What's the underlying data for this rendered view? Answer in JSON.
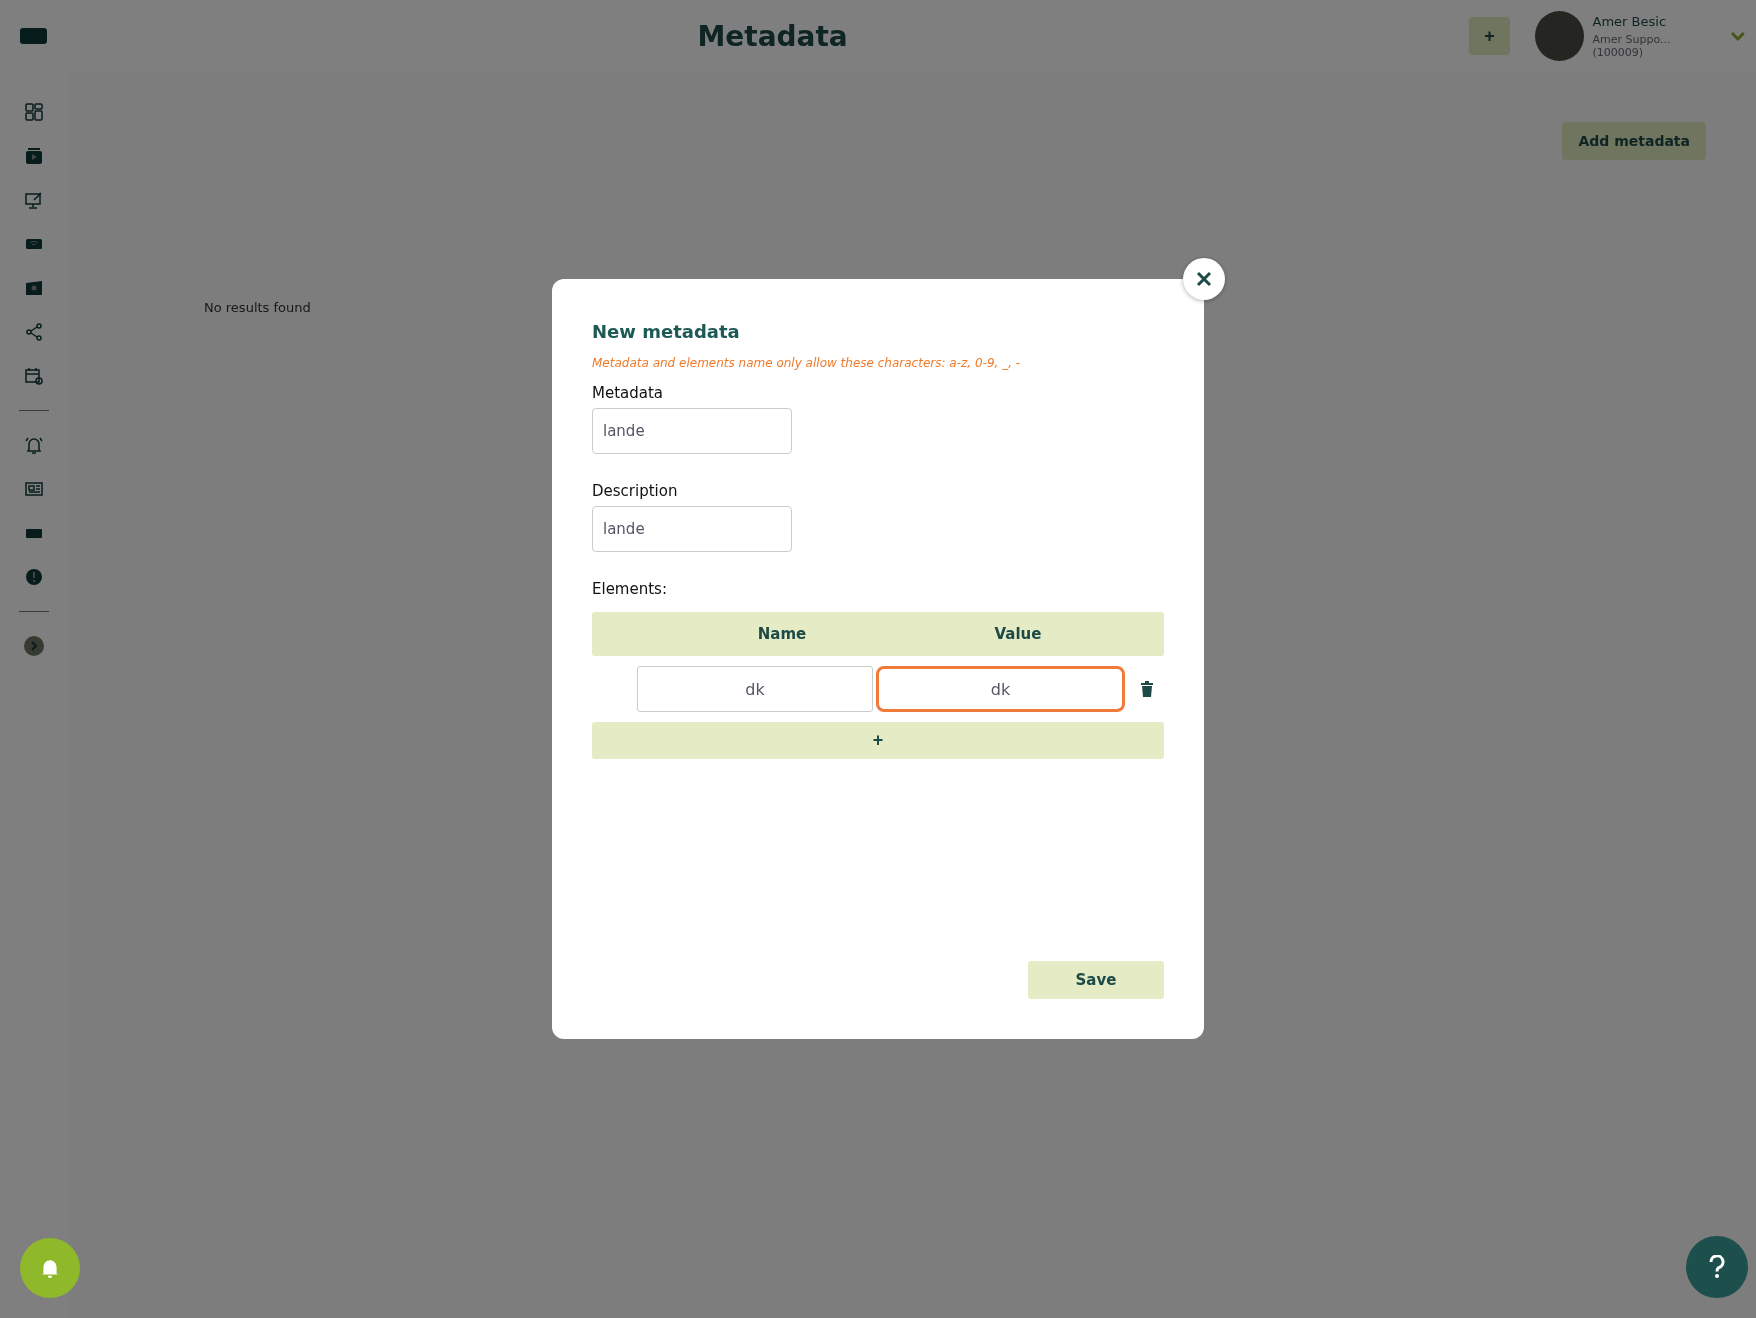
{
  "header": {
    "title": "Metadata",
    "add_button": "+",
    "user": {
      "name": "Amer Besic",
      "subtitle": "Amer Suppo...(100009)"
    }
  },
  "toolbar": {
    "add_metadata_button": "Add metadata"
  },
  "empty_message": "No results found",
  "modal": {
    "title": "New metadata",
    "hint": "Metadata and elements name only allow these characters: a-z, 0-9, _, -",
    "fields": [
      {
        "label": "Metadata",
        "value": "lande"
      },
      {
        "label": "Description",
        "value": "lande"
      }
    ],
    "elements_label": "Elements:",
    "columns": [
      "Name",
      "Value"
    ],
    "elements": [
      {
        "name": "dk",
        "value": "dk",
        "value_focused": true
      }
    ],
    "add_row_button": "+",
    "save_button": "Save"
  }
}
